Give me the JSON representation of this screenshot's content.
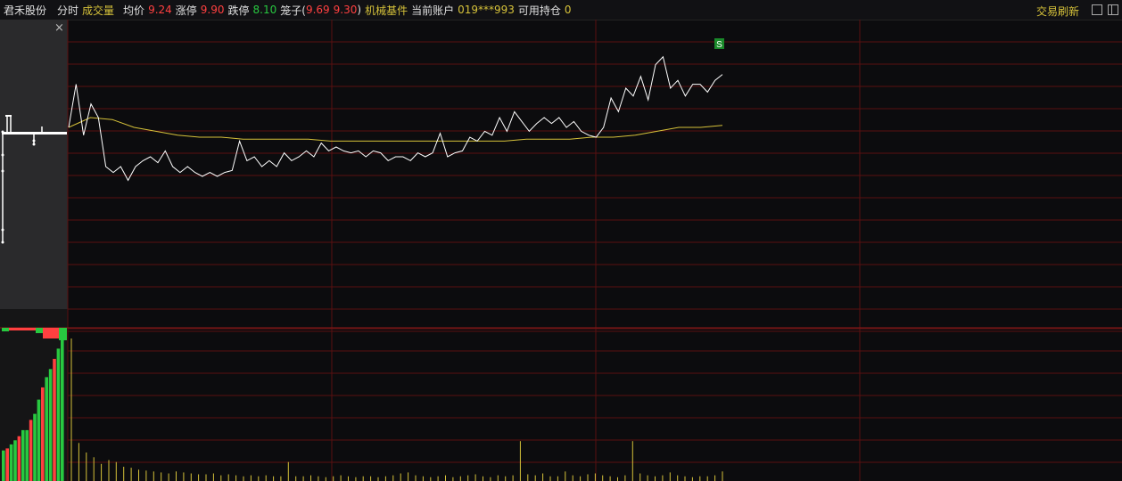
{
  "header": {
    "stock_name": "君禾股份",
    "tab_intraday": "分时",
    "tab_volume": "成交量",
    "avg_label": "均价",
    "avg_value": "9.24",
    "limit_up_label": "涨停",
    "limit_up_value": "9.90",
    "limit_down_label": "跌停",
    "limit_down_value": "8.10",
    "cage_label": "笼子(",
    "cage_low": "9.69",
    "cage_high": "9.30",
    "cage_close": ")",
    "sector": "机械基件",
    "account_label": "当前账户",
    "account_value": "019***993",
    "holdings_label": "可用持仓",
    "holdings_value": "0",
    "refresh_label": "交易刷新"
  },
  "panel": {
    "close_symbol": "×"
  },
  "colors": {
    "up": "#ff4040",
    "down": "#28c840",
    "accent": "#d6c23a",
    "price": "#ffffff",
    "grid": "#5a1010"
  },
  "chart_data": {
    "type": "line",
    "title": "",
    "marker_label": "S",
    "series": [
      {
        "values": [
          9.5,
          9.72,
          9.46,
          9.62,
          9.55,
          9.3,
          9.27,
          9.3,
          9.23,
          9.3,
          9.33,
          9.35,
          9.32,
          9.38,
          9.3,
          9.27,
          9.3,
          9.27,
          9.25,
          9.27,
          9.25,
          9.27,
          9.28,
          9.43,
          9.33,
          9.35,
          9.3,
          9.33,
          9.3,
          9.37,
          9.33,
          9.35,
          9.38,
          9.35,
          9.42,
          9.38,
          9.4,
          9.38,
          9.37,
          9.38,
          9.35,
          9.38,
          9.37,
          9.33,
          9.35,
          9.35,
          9.33,
          9.37,
          9.35,
          9.37,
          9.47,
          9.35,
          9.37,
          9.38,
          9.45,
          9.43,
          9.48,
          9.46,
          9.55,
          9.48,
          9.58,
          9.53,
          9.48,
          9.52,
          9.55,
          9.52,
          9.55,
          9.5,
          9.53,
          9.48,
          9.46,
          9.45,
          9.5,
          9.65,
          9.58,
          9.7,
          9.66,
          9.76,
          9.64,
          9.82,
          9.86,
          9.7,
          9.74,
          9.66,
          9.72,
          9.72,
          9.68,
          9.74,
          9.77
        ]
      },
      {
        "values": [
          9.5,
          9.55,
          9.54,
          9.5,
          9.48,
          9.46,
          9.45,
          9.45,
          9.44,
          9.44,
          9.44,
          9.44,
          9.43,
          9.43,
          9.43,
          9.43,
          9.43,
          9.43,
          9.43,
          9.43,
          9.43,
          9.44,
          9.44,
          9.44,
          9.45,
          9.45,
          9.46,
          9.48,
          9.5,
          9.5,
          9.51
        ]
      }
    ],
    "volume": [
      150,
      40,
      30,
      25,
      18,
      22,
      20,
      15,
      14,
      12,
      11,
      10,
      9,
      8,
      10,
      9,
      8,
      7,
      7,
      8,
      6,
      7,
      6,
      5,
      6,
      5,
      6,
      5,
      5,
      20,
      5,
      5,
      6,
      5,
      4,
      5,
      6,
      5,
      4,
      5,
      5,
      4,
      5,
      6,
      8,
      9,
      6,
      5,
      4,
      5,
      6,
      4,
      5,
      6,
      7,
      5,
      4,
      6,
      5,
      6,
      42,
      7,
      6,
      8,
      5,
      5,
      10,
      6,
      5,
      7,
      8,
      6,
      5,
      4,
      6,
      42,
      8,
      6,
      5,
      6,
      9,
      6,
      5,
      4,
      5,
      5,
      6,
      10
    ],
    "buy_sell_bars": [
      15,
      16,
      18,
      20,
      22,
      25,
      25,
      30,
      33,
      40,
      46,
      51,
      55,
      60,
      65,
      70
    ]
  }
}
